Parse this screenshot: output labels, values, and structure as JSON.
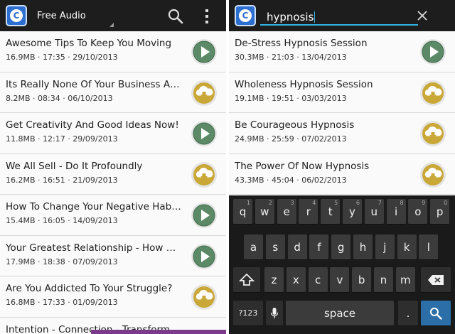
{
  "left": {
    "title": "Free Audio",
    "items": [
      {
        "title": "Awesome Tips To Keep You Moving",
        "meta": "16.9MB · 17:35 · 29/10/2013",
        "action": "play"
      },
      {
        "title": "Its Really None Of Your Business Anyway",
        "meta": "8.2MB · 08:34 · 06/10/2013",
        "action": "download"
      },
      {
        "title": "Get Creativity And Good Ideas Now!",
        "meta": "11.8MB · 12:17 · 29/09/2013",
        "action": "play"
      },
      {
        "title": "We All Sell - Do It Profoundly",
        "meta": "16.2MB · 16:51 · 21/09/2013",
        "action": "download"
      },
      {
        "title": "How To Change Your Negative Habits Forever",
        "meta": "15.4MB · 16:05 · 14/09/2013",
        "action": "play"
      },
      {
        "title": "Your Greatest Relationship - How We Relate",
        "meta": "17.9MB · 18:38 · 07/09/2013",
        "action": "play"
      },
      {
        "title": "Are You Addicted To Your Struggle?",
        "meta": "16.8MB · 17:33 · 01/09/2013",
        "action": "download"
      }
    ],
    "partial_item": "Intention - Connection - Transform"
  },
  "right": {
    "search_query": "hypnosis",
    "items": [
      {
        "title": "De-Stress Hypnosis Session",
        "meta": "30.3MB · 21:03 · 13/04/2013",
        "action": "play"
      },
      {
        "title": "Wholeness Hypnosis Session",
        "meta": "19.1MB · 19:51 · 03/03/2013",
        "action": "download"
      },
      {
        "title": "Be Courageous Hypnosis",
        "meta": "24.9MB · 25:59 · 07/02/2013",
        "action": "download"
      },
      {
        "title": "The Power Of Now Hypnosis",
        "meta": "43.3MB · 45:04 · 06/02/2013",
        "action": "download"
      }
    ],
    "keyboard": {
      "row1": [
        {
          "k": "q",
          "h": "1"
        },
        {
          "k": "w",
          "h": "2"
        },
        {
          "k": "e",
          "h": "3"
        },
        {
          "k": "r",
          "h": "4"
        },
        {
          "k": "t",
          "h": "5"
        },
        {
          "k": "y",
          "h": "6"
        },
        {
          "k": "u",
          "h": "7"
        },
        {
          "k": "i",
          "h": "8"
        },
        {
          "k": "o",
          "h": "9"
        },
        {
          "k": "p",
          "h": "0"
        }
      ],
      "row2": [
        "a",
        "s",
        "d",
        "f",
        "g",
        "h",
        "j",
        "k",
        "l"
      ],
      "row3": [
        "z",
        "x",
        "c",
        "v",
        "b",
        "n",
        "m"
      ],
      "symbols_label": "?123",
      "period_label": ".",
      "comma_label": ","
    }
  },
  "colors": {
    "play": "#5c8a66",
    "download": "#c9a838",
    "accent": "#33b5e5"
  }
}
